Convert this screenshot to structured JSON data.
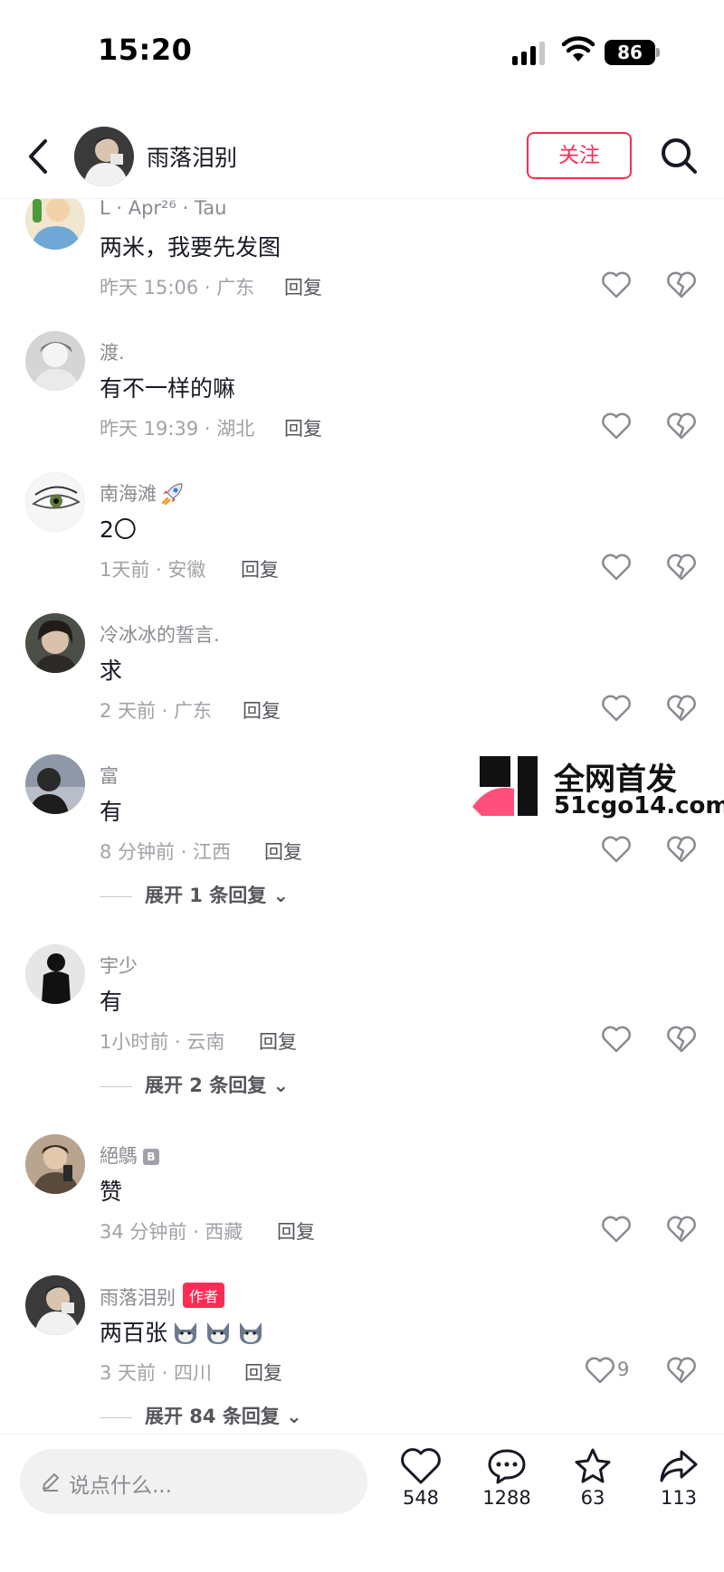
{
  "status_bar": {
    "time": "15:20",
    "battery": "86"
  },
  "header": {
    "username": "雨落泪别",
    "follow_label": "关注"
  },
  "comments": [
    {
      "user": "L · Apr²⁶ · Tau",
      "text": "两米，我要先发图",
      "time": "昨天 15:06 · 广东",
      "reply_label": "回复"
    },
    {
      "user": "渡.",
      "text": "有不一样的嘛",
      "time": "昨天 19:39 · 湖北",
      "reply_label": "回复"
    },
    {
      "user": "南海滩",
      "text": "2〇",
      "time": "1天前 · 安徽",
      "reply_label": "回复"
    },
    {
      "user": "冷冰冰的誓言.",
      "text": "求",
      "time": "2 天前 · 广东",
      "reply_label": "回复"
    },
    {
      "user": "富",
      "text": "有",
      "time": "8 分钟前 · 江西",
      "reply_label": "回复",
      "expand": "展开 1 条回复"
    },
    {
      "user": "宇少",
      "text": "有",
      "time": "1小时前 · 云南",
      "reply_label": "回复",
      "expand": "展开 2 条回复"
    },
    {
      "user": "絕鷌",
      "text": "赞",
      "time": "34 分钟前 · 西藏",
      "reply_label": "回复"
    },
    {
      "user": "雨落泪别",
      "author_badge": "作者",
      "text": "两百张",
      "time": "3 天前 · 四川",
      "reply_label": "回复",
      "likes": "9",
      "expand": "展开 84 条回复"
    }
  ],
  "watermark": {
    "line1": "全网首发",
    "line2": "51cgo14.com"
  },
  "bottom_bar": {
    "input_placeholder": "说点什么...",
    "likes": "548",
    "comments": "1288",
    "favorites": "63",
    "shares": "113"
  },
  "colors": {
    "accent": "#fe2c55",
    "text": "#161823",
    "muted": "#8a8b91"
  }
}
